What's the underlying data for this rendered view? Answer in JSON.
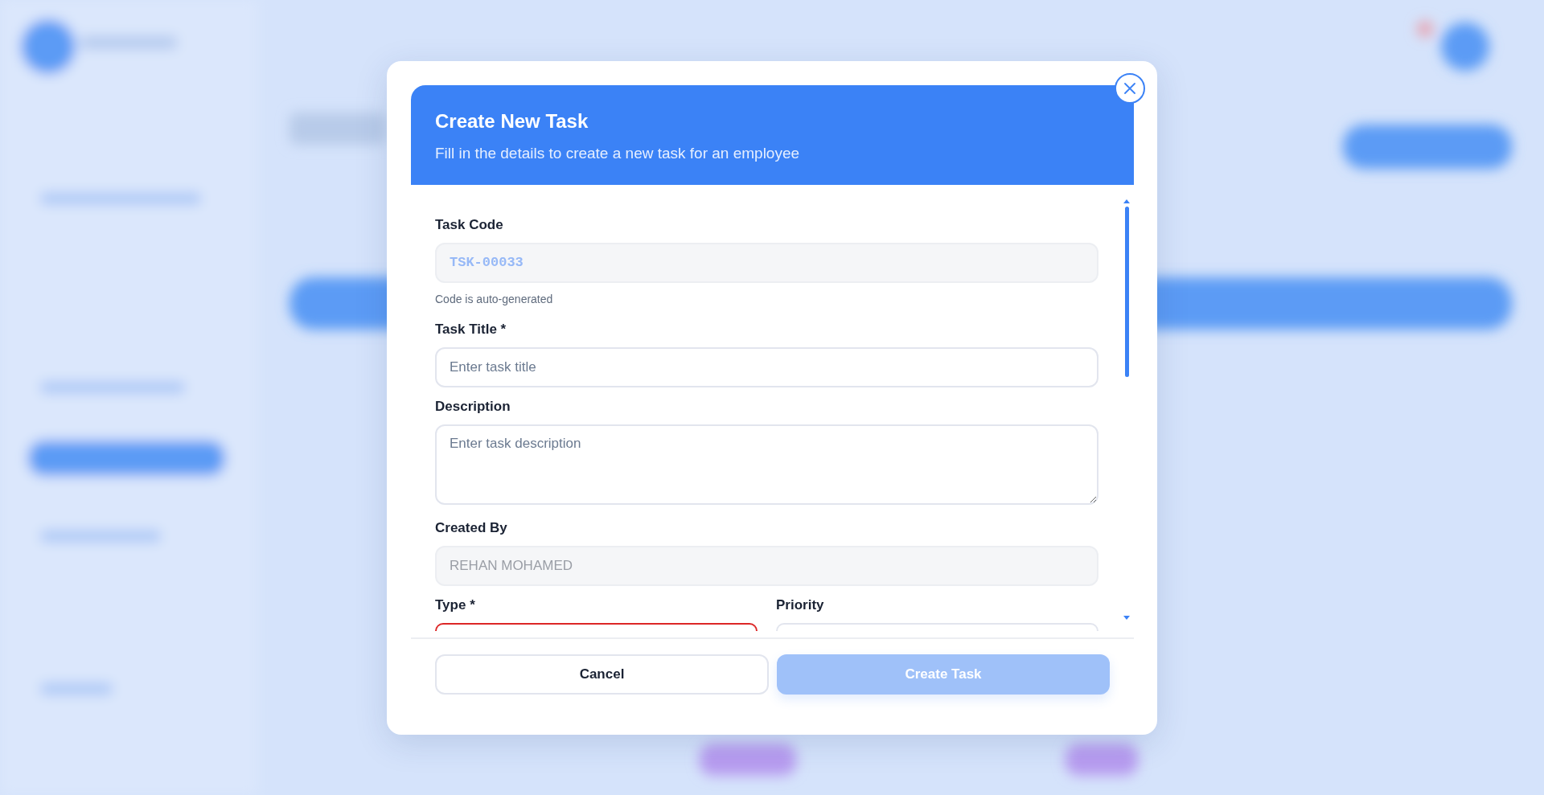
{
  "dialog": {
    "title": "Create New Task",
    "subtitle": "Fill in the details to create a new task for an employee"
  },
  "fields": [
    {
      "kind": "readonly",
      "label": "Task Code",
      "value": "TSK-00033",
      "mono": true,
      "hint": "Code is auto-generated"
    },
    {
      "kind": "text",
      "label": "Task Title *",
      "placeholder": "Enter task title"
    },
    {
      "kind": "textarea",
      "label": "Description",
      "placeholder": "Enter task description"
    },
    {
      "kind": "readonly",
      "label": "Created By",
      "value": "REHAN MOHAMED",
      "mono": false
    }
  ],
  "row_fields": [
    {
      "label": "Type *",
      "invalid": true
    },
    {
      "label": "Priority",
      "invalid": false
    }
  ],
  "buttons": [
    {
      "kind": "cancel",
      "label": "Cancel",
      "disabled": false
    },
    {
      "kind": "submit",
      "label": "Create Task",
      "disabled": true
    }
  ]
}
